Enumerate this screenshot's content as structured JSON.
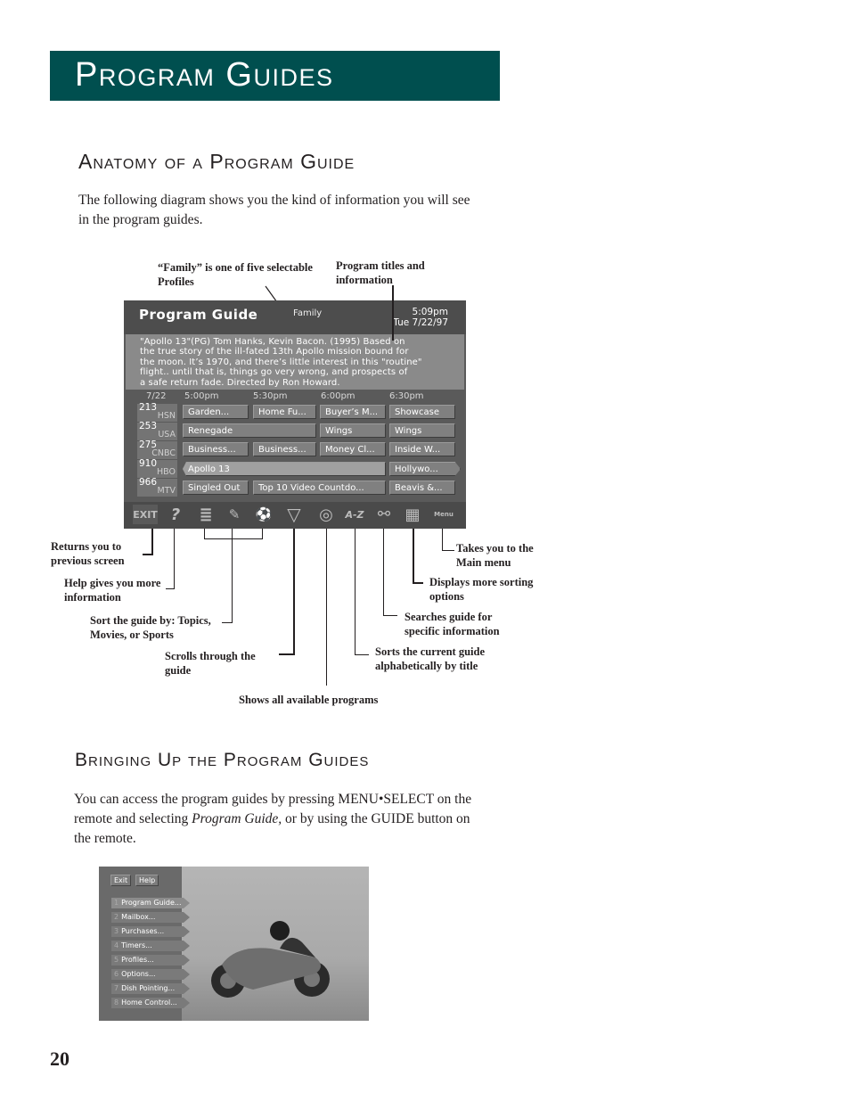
{
  "header": {
    "title": "Program Guides"
  },
  "section1": {
    "heading": "Anatomy of a Program Guide",
    "intro_line1": "The following diagram shows you the kind of information you will see",
    "intro_line2": "in the program guides."
  },
  "callouts": {
    "family_1": "“Family” is one of five selectable",
    "family_2": "Profiles",
    "titles_1": "Program titles and",
    "titles_2": "information",
    "exit_1": "Returns you to",
    "exit_2": "previous screen",
    "help_1": "Help gives you more",
    "help_2": "information",
    "sort_1": "Sort the guide by: Topics,",
    "sort_2": "Movies, or Sports",
    "scroll_1": "Scrolls through the",
    "scroll_2": "guide",
    "all": "Shows all available programs",
    "az_1": "Sorts the current guide",
    "az_2": "alphabetically by title",
    "search_1": "Searches guide for",
    "search_2": "specific information",
    "more_1": "Displays more sorting",
    "more_2": "options",
    "menu_1": "Takes you to the",
    "menu_2": "Main menu"
  },
  "guide": {
    "title": "Program Guide",
    "profile": "Family",
    "time": "5:09pm",
    "date": "Tue 7/22/97",
    "description": [
      "\"Apollo 13\"(PG) Tom Hanks, Kevin Bacon. (1995) Based on",
      "the true story of the ill-fated 13th Apollo mission bound for",
      "the moon. It’s 1970, and there’s little interest in this \"routine\"",
      "flight.. until that is, things go very wrong, and prospects of",
      "a safe return fade. Directed by Ron Howard."
    ],
    "grid_date": "7/22",
    "time_slots": [
      "5:00pm",
      "5:30pm",
      "6:00pm",
      "6:30pm"
    ],
    "channels": [
      {
        "number": "213",
        "call": "HSN",
        "programs": [
          "Garden...",
          "Home Fu...",
          "Buyer’s M...",
          "Showcase"
        ]
      },
      {
        "number": "253",
        "call": "USA",
        "programs": [
          "Renegade",
          "Wings",
          "Wings"
        ]
      },
      {
        "number": "275",
        "call": "CNBC",
        "programs": [
          "Business...",
          "Business...",
          "Money Cl...",
          "Inside W..."
        ]
      },
      {
        "number": "910",
        "call": "HBO",
        "programs": [
          "Apollo 13",
          "Hollywo..."
        ]
      },
      {
        "number": "966",
        "call": "MTV",
        "programs": [
          "Singled Out",
          "Top 10 Video Countdo...",
          "Beavis &..."
        ]
      }
    ],
    "toolbar": [
      {
        "icon": "exit-icon",
        "label": "EXIT"
      },
      {
        "icon": "help-icon",
        "label": "?"
      },
      {
        "icon": "topics-icon",
        "label": "≣"
      },
      {
        "icon": "movies-icon",
        "label": "✎"
      },
      {
        "icon": "sports-icon",
        "label": "⚽"
      },
      {
        "icon": "scroll-down-icon",
        "label": "▽"
      },
      {
        "icon": "all-programs-icon",
        "label": "◎"
      },
      {
        "icon": "az-sort-icon",
        "label": "A-Z"
      },
      {
        "icon": "search-binoculars-icon",
        "label": "⚯"
      },
      {
        "icon": "sort-options-icon",
        "label": "▦"
      },
      {
        "icon": "main-menu-icon",
        "label": "Menu"
      }
    ]
  },
  "section2": {
    "heading": "Bringing Up the Program Guides",
    "p_line1": "You can access the program guides by pressing MENU•SELECT on the",
    "p_line2_a": "remote and selecting ",
    "p_line2_em": "Program Guide,",
    "p_line2_b": " or by using the GUIDE button on",
    "p_line3": "the remote."
  },
  "main_menu": {
    "exit": "Exit",
    "help": "Help",
    "items": [
      {
        "n": "1",
        "label": "Program Guide..."
      },
      {
        "n": "2",
        "label": "Mailbox..."
      },
      {
        "n": "3",
        "label": "Purchases..."
      },
      {
        "n": "4",
        "label": "Timers..."
      },
      {
        "n": "5",
        "label": "Profiles..."
      },
      {
        "n": "6",
        "label": "Options..."
      },
      {
        "n": "7",
        "label": "Dish Pointing..."
      },
      {
        "n": "8",
        "label": "Home Control..."
      }
    ]
  },
  "footer": {
    "page_number": "20"
  }
}
